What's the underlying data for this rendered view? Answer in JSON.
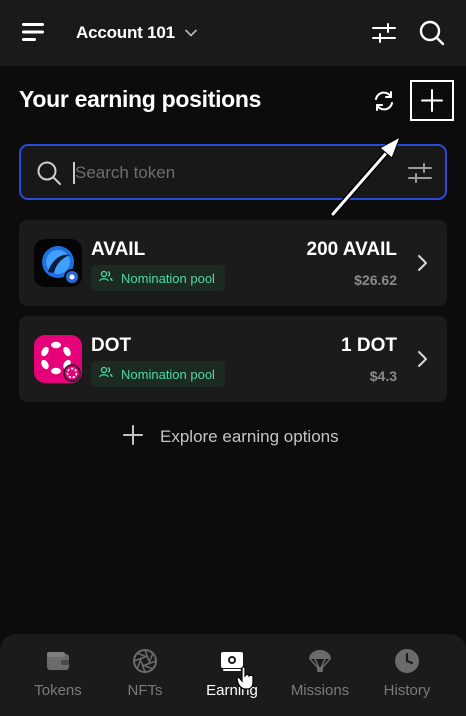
{
  "header": {
    "account_name": "Account 101"
  },
  "page": {
    "title": "Your earning positions"
  },
  "search": {
    "placeholder": "Search token"
  },
  "positions": [
    {
      "symbol": "AVAIL",
      "pool_type": "Nomination pool",
      "amount": "200 AVAIL",
      "value": "$26.62",
      "logo_color": "#3b82f6"
    },
    {
      "symbol": "DOT",
      "pool_type": "Nomination pool",
      "amount": "1 DOT",
      "value": "$4.3",
      "logo_color": "#e6007a"
    }
  ],
  "explore": {
    "label": "Explore earning options"
  },
  "bottom_nav": {
    "items": [
      {
        "label": "Tokens",
        "icon": "wallet-icon"
      },
      {
        "label": "NFTs",
        "icon": "aperture-icon"
      },
      {
        "label": "Earning",
        "icon": "earning-icon",
        "active": true
      },
      {
        "label": "Missions",
        "icon": "parachute-icon"
      },
      {
        "label": "History",
        "icon": "clock-icon"
      }
    ]
  },
  "colors": {
    "accent_border": "#2a4bd7",
    "badge_text": "#4cd9ac",
    "badge_bg": "#1c2a23"
  }
}
